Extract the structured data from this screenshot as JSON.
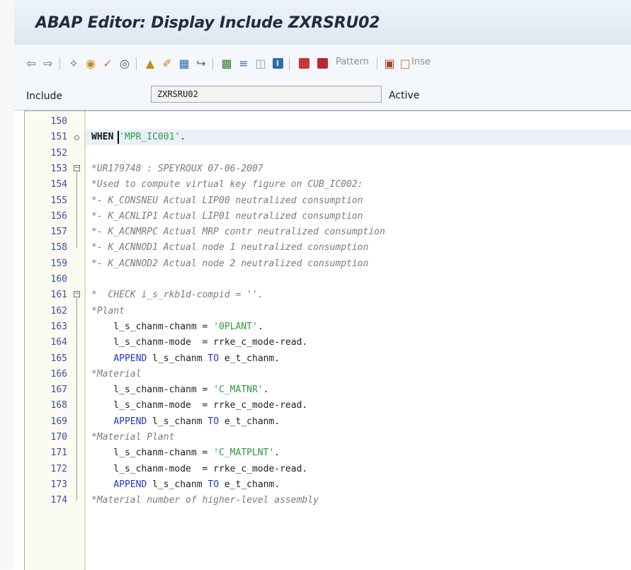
{
  "title": "ABAP Editor: Display Include ZXRSRU02",
  "toolbar": {
    "pattern_label": "Pattern",
    "insert_label": "Inse"
  },
  "include": {
    "label": "Include",
    "value": "ZXRSRU02",
    "status": "Active"
  },
  "code_lines": [
    {
      "n": "150",
      "text": ""
    },
    {
      "n": "151",
      "text": "WHEN 'MPR_IC001'."
    },
    {
      "n": "152",
      "text": ""
    },
    {
      "n": "153",
      "text": "*UR179748 : SPEYROUX 07-06-2007"
    },
    {
      "n": "154",
      "text": "*Used to compute virtual key figure on CUB_IC002:"
    },
    {
      "n": "155",
      "text": "*- K_CONSNEU Actual LIP00 neutralized consumption"
    },
    {
      "n": "156",
      "text": "*- K_ACNLIP1 Actual LIP01 neutralized consumption"
    },
    {
      "n": "157",
      "text": "*- K_ACNMRPC Actual MRP contr neutralized consumption"
    },
    {
      "n": "158",
      "text": "*- K_ACNNOD1 Actual node 1 neutralized consumption"
    },
    {
      "n": "159",
      "text": "*- K_ACNNOD2 Actual node 2 neutralized consumption"
    },
    {
      "n": "160",
      "text": ""
    },
    {
      "n": "161",
      "text": "*  CHECK i_s_rkb1d-compid = ''."
    },
    {
      "n": "162",
      "text": "*Plant"
    },
    {
      "n": "163",
      "text": "    l_s_chanm-chanm = '0PLANT'."
    },
    {
      "n": "164",
      "text": "    l_s_chanm-mode  = rrke_c_mode-read."
    },
    {
      "n": "165",
      "text": "    APPEND l_s_chanm TO e_t_chanm."
    },
    {
      "n": "166",
      "text": "*Material"
    },
    {
      "n": "167",
      "text": "    l_s_chanm-chanm = 'C_MATNR'."
    },
    {
      "n": "168",
      "text": "    l_s_chanm-mode  = rrke_c_mode-read."
    },
    {
      "n": "169",
      "text": "    APPEND l_s_chanm TO e_t_chanm."
    },
    {
      "n": "170",
      "text": "*Material Plant"
    },
    {
      "n": "171",
      "text": "    l_s_chanm-chanm = 'C_MATPLNT'."
    },
    {
      "n": "172",
      "text": "    l_s_chanm-mode  = rrke_c_mode-read."
    },
    {
      "n": "173",
      "text": "    APPEND l_s_chanm TO e_t_chanm."
    },
    {
      "n": "174",
      "text": "*Material number of higher-level assembly"
    }
  ]
}
